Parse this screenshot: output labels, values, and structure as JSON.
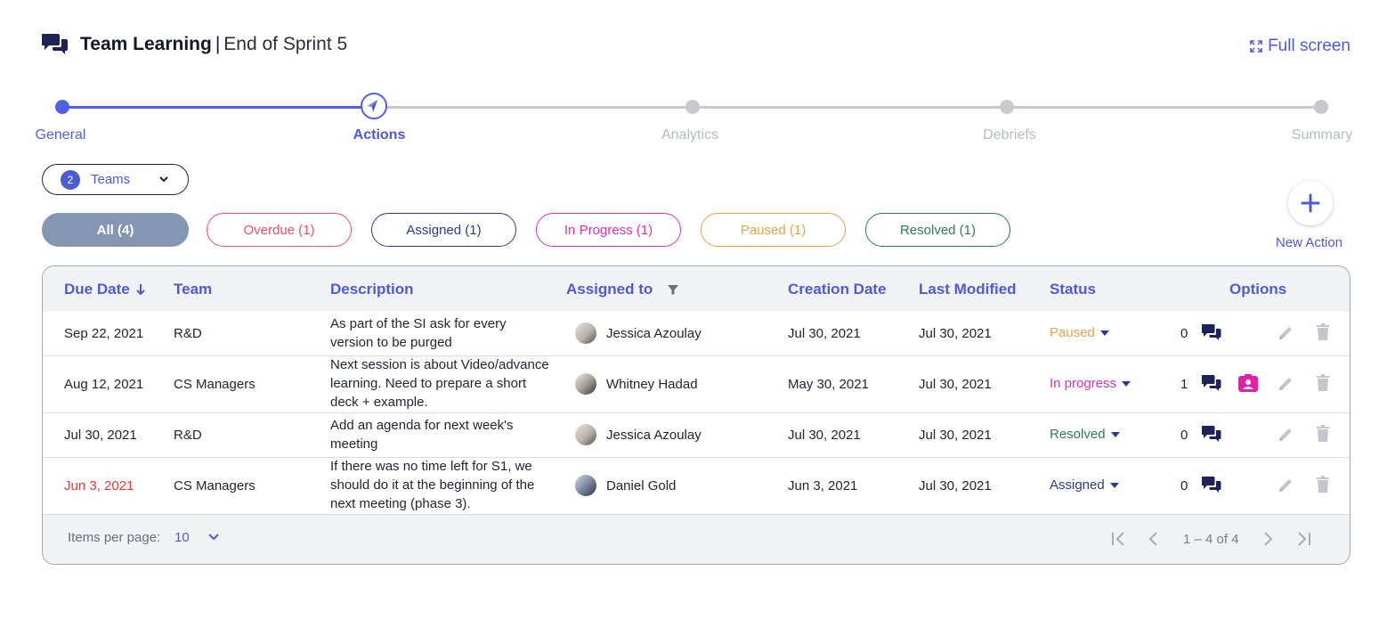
{
  "header": {
    "title_bold": "Team Learning",
    "separator": "|",
    "title_sub": "End of Sprint 5",
    "fullscreen_label": "Full screen"
  },
  "stepper": {
    "steps": [
      {
        "label": "General",
        "state": "done"
      },
      {
        "label": "Actions",
        "state": "current"
      },
      {
        "label": "Analytics",
        "state": "todo"
      },
      {
        "label": "Debriefs",
        "state": "todo"
      },
      {
        "label": "Summary",
        "state": "todo"
      }
    ]
  },
  "teams_filter": {
    "count": "2",
    "label": "Teams"
  },
  "filters": [
    {
      "label": "All (4)",
      "color": "#8596b3"
    },
    {
      "label": "Overdue (1)",
      "color": "#e4526f"
    },
    {
      "label": "Assigned (1)",
      "color": "#2b3c8e"
    },
    {
      "label": "In Progress (1)",
      "color": "#d435b9"
    },
    {
      "label": "Paused (1)",
      "color": "#eba04e"
    },
    {
      "label": "Resolved (1)",
      "color": "#2e7d4f"
    }
  ],
  "new_action": {
    "label": "New Action"
  },
  "table": {
    "columns": [
      "Due Date",
      "Team",
      "Description",
      "Assigned to",
      "Creation Date",
      "Last Modified",
      "Status",
      "Options"
    ],
    "rows": [
      {
        "due": "Sep 22, 2021",
        "team": "R&D",
        "desc": "As part of the SI ask for every version to be purged",
        "assignee": "Jessica Azoulay",
        "created": "Jul 30, 2021",
        "modified": "Jul 30, 2021",
        "status": "Paused",
        "comments": "0"
      },
      {
        "due": "Aug 12, 2021",
        "team": "CS Managers",
        "desc": "Next session is about Video/advance learning. Need to prepare a short deck + example.",
        "assignee": "Whitney Hadad",
        "created": "May 30, 2021",
        "modified": "Jul 30, 2021",
        "status": "In progress",
        "comments": "1"
      },
      {
        "due": "Jul 30, 2021",
        "team": "R&D",
        "desc": "Add an agenda for next week's meeting",
        "assignee": "Jessica Azoulay",
        "created": "Jul 30, 2021",
        "modified": "Jul 30, 2021",
        "status": "Resolved",
        "comments": "0"
      },
      {
        "due": "Jun 3, 2021",
        "team": "CS Managers",
        "desc": "If there was no time left for S1, we should do it at the beginning of the next meeting (phase 3).",
        "assignee": "Daniel Gold",
        "created": "Jun 3, 2021",
        "modified": "Jul 30, 2021",
        "status": "Assigned",
        "comments": "0"
      }
    ]
  },
  "pagination": {
    "items_per_page_label": "Items per page:",
    "items_per_page": "10",
    "range": "1 – 4 of 4"
  },
  "colors": {
    "accent": "#4f5bd5",
    "overdue": "#e03a3a",
    "paused": "#eba04e",
    "in_progress": "#d435b9",
    "resolved": "#2e7d4f",
    "assigned": "#2b3c8e",
    "icon_dark": "#1b2357",
    "icon_muted": "#c3c6cc"
  },
  "icons": [
    "chat-bubbles-icon",
    "expand-icon",
    "compass-icon",
    "chevron-down-icon",
    "plus-icon",
    "sort-arrow-down-icon",
    "filter-icon",
    "caret-down-icon",
    "contact-card-icon",
    "pencil-icon",
    "trash-icon",
    "first-page-icon",
    "prev-page-icon",
    "next-page-icon",
    "last-page-icon"
  ]
}
